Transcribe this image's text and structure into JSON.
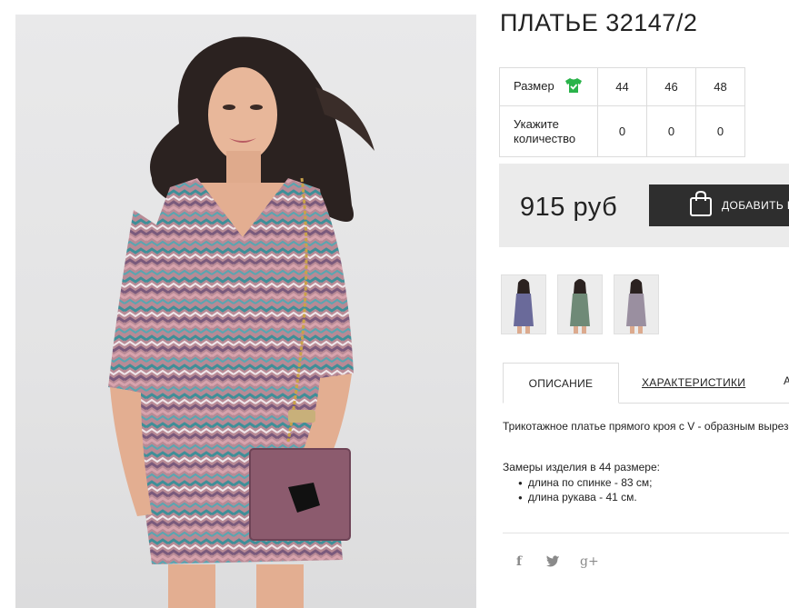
{
  "product": {
    "title": "ПЛАТЬЕ 32147/2",
    "main_photo_alt": "Платье 32147/2"
  },
  "size_table": {
    "size_label": "Размер",
    "size_icon": "tshirt-check-icon",
    "sizes": [
      "44",
      "46",
      "48"
    ],
    "qty_label_line1": "Укажите",
    "qty_label_line2": "количество",
    "quantities": [
      "0",
      "0",
      "0"
    ]
  },
  "purchase": {
    "price": "915 руб",
    "add_to_cart_label": "ДОБАВИТЬ В КОРЗИНУ",
    "cart_icon": "shopping-bag-icon"
  },
  "thumbnails": [
    {
      "name": "thumbnail-1",
      "dress_color": "#6a6a9a"
    },
    {
      "name": "thumbnail-2",
      "dress_color": "#6f8a77"
    },
    {
      "name": "thumbnail-3",
      "dress_color": "#9a8fa0"
    }
  ],
  "tabs": {
    "description": "ОПИСАНИЕ",
    "characteristics": "ХАРАКТЕРИСТИКИ",
    "more": "А"
  },
  "description": {
    "text": "Трикотажное платье прямого кроя с V - образным вырезом",
    "measures_title": "Замеры изделия в 44 размере:",
    "measures": [
      "длина по спинке - 83 см;",
      "длина рукава - 41 см."
    ]
  },
  "social": {
    "facebook": "f",
    "twitter": "🐦",
    "googleplus": "g+"
  },
  "colors": {
    "accent_dark": "#2e2e2e",
    "price_bg": "#ebebeb",
    "size_icon_green": "#2ab34a",
    "social_gray": "#8a8a8a"
  }
}
